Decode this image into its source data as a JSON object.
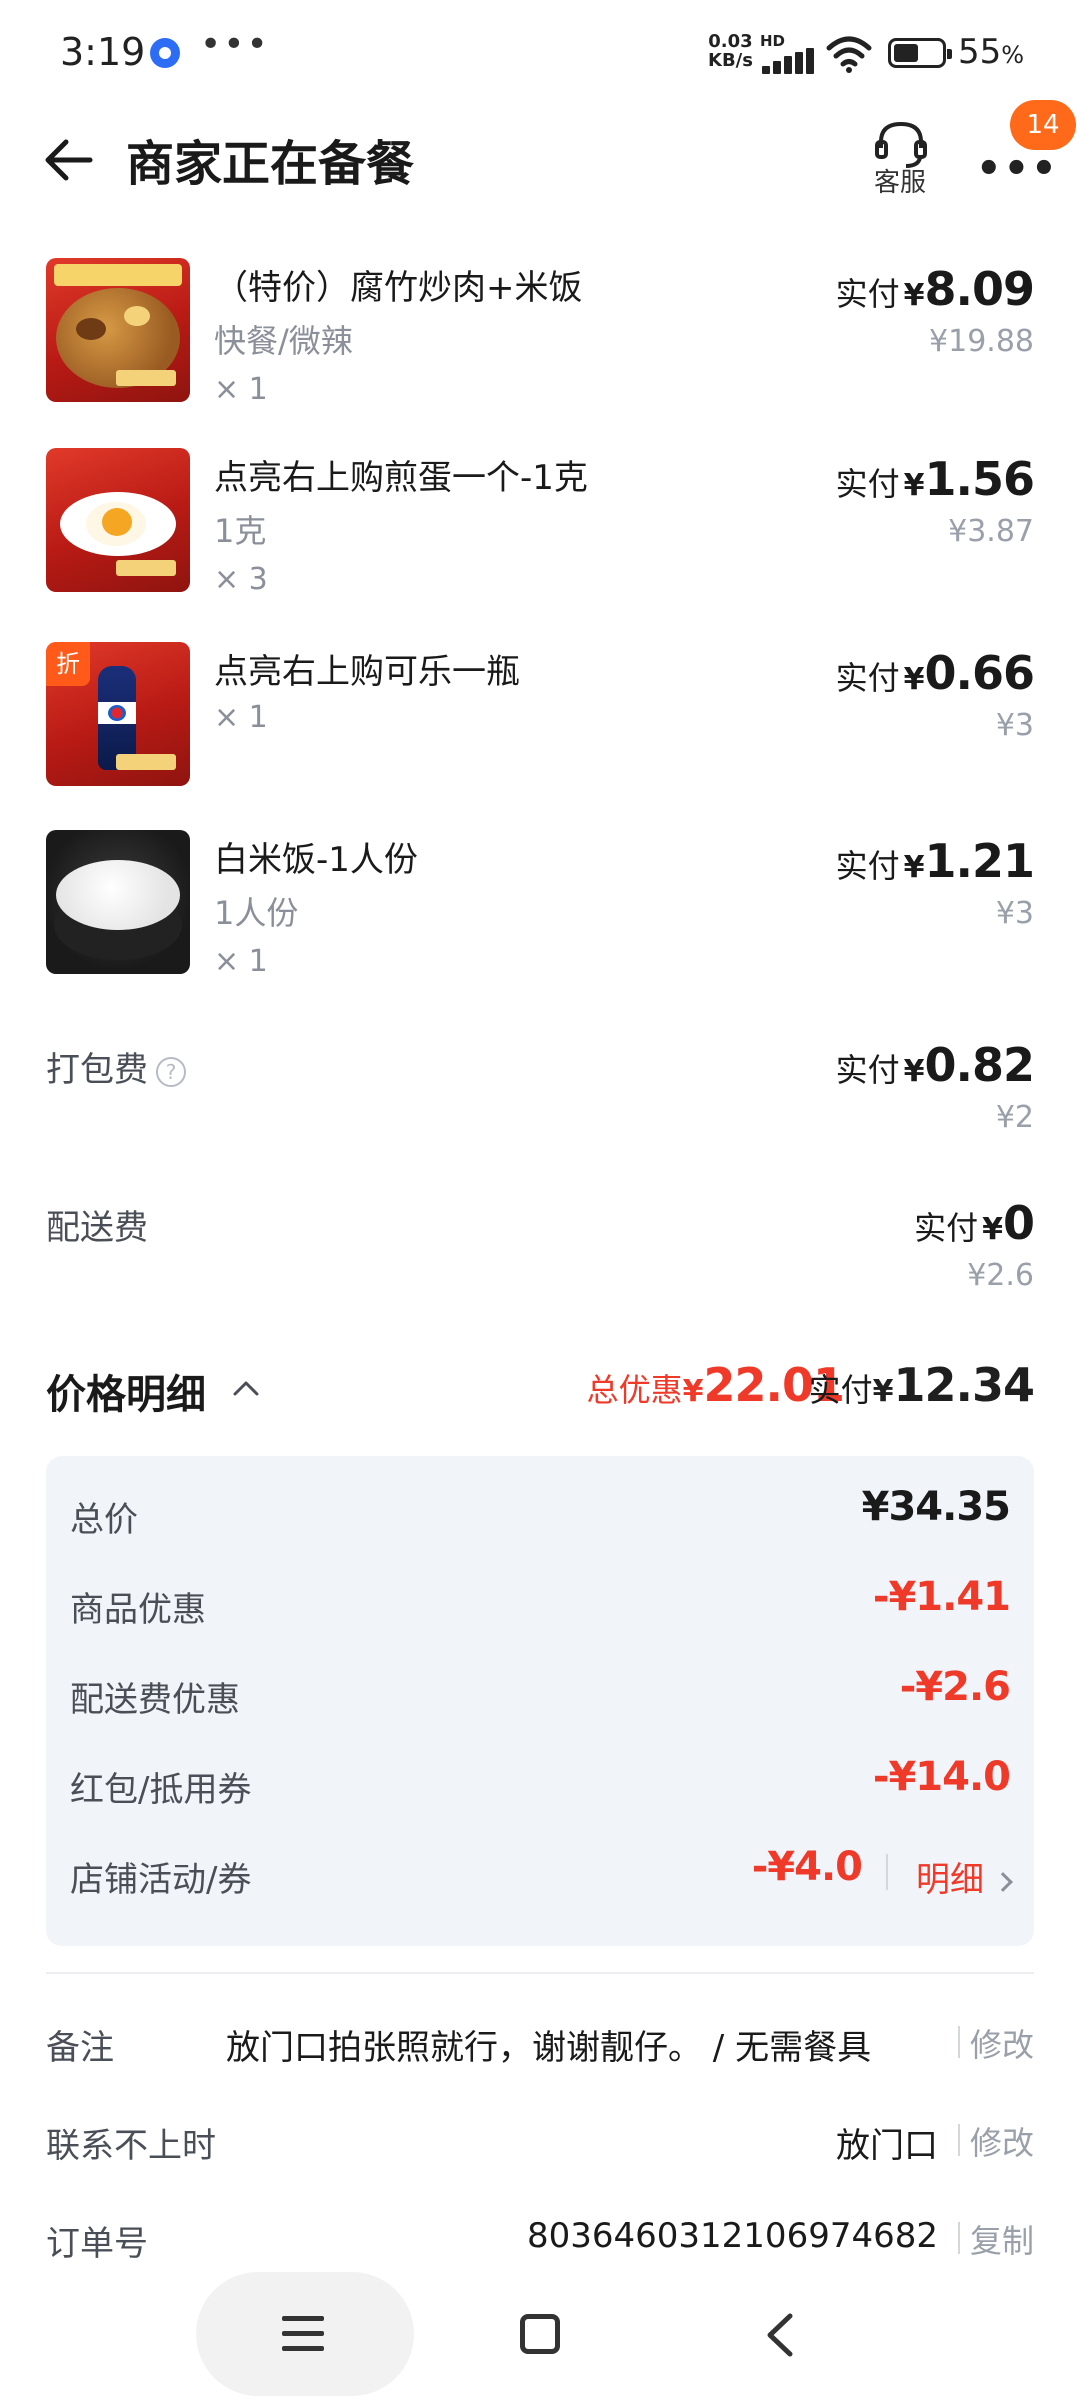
{
  "status_bar": {
    "time": "3:19",
    "dots": "•••",
    "net_speed_top": "0.03",
    "net_speed_bottom": "KB/s",
    "network_type": "HD",
    "battery_level": "55",
    "battery_unit": "%"
  },
  "header": {
    "title": "商家正在备餐",
    "customer_service_label": "客服",
    "notification_count": "14"
  },
  "items": [
    {
      "name": "（特价）腐竹炒肉+米饭",
      "spec": "快餐/微辣",
      "qty": "× 1",
      "pay_label": "实付",
      "yen": "¥",
      "pay": "8.09",
      "original": "¥19.88"
    },
    {
      "name": "点亮右上购煎蛋一个-1克",
      "spec": "1克",
      "qty": "× 3",
      "pay_label": "实付",
      "yen": "¥",
      "pay": "1.56",
      "original": "¥3.87"
    },
    {
      "name": "点亮右上购可乐一瓶",
      "qty": "× 1",
      "tag": "折",
      "pay_label": "实付",
      "yen": "¥",
      "pay": "0.66",
      "original": "¥3"
    },
    {
      "name": "白米饭-1人份",
      "spec": "1人份",
      "qty": "× 1",
      "pay_label": "实付",
      "yen": "¥",
      "pay": "1.21",
      "original": "¥3"
    }
  ],
  "fees": {
    "packing": {
      "label": "打包费",
      "help": "?",
      "pay_label": "实付",
      "yen": "¥",
      "pay": "0.82",
      "original": "¥2"
    },
    "delivery": {
      "label": "配送费",
      "pay_label": "实付",
      "yen": "¥",
      "pay": "0",
      "original": "¥2.6"
    }
  },
  "price_detail": {
    "title": "价格明细",
    "total_discount_label": "总优惠",
    "total_discount_yen": "¥",
    "total_discount": "22.01",
    "paid_label": "实付",
    "paid_yen": "¥",
    "paid": "12.34",
    "rows": [
      {
        "label": "总价",
        "value": "¥34.35"
      },
      {
        "label": "商品优惠",
        "value": "-¥1.41"
      },
      {
        "label": "配送费优惠",
        "value": "-¥2.6"
      },
      {
        "label": "红包/抵用券",
        "value": "-¥14.0"
      },
      {
        "label": "店铺活动/券",
        "value": "-¥4.0",
        "link": "明细"
      }
    ]
  },
  "order_info": {
    "note_label": "备注",
    "note_value": "放门口拍张照就行，谢谢靓仔。 / 无需餐具",
    "note_action": "修改",
    "unreachable_label": "联系不上时",
    "unreachable_value": "放门口",
    "unreachable_action": "修改",
    "order_no_label": "订单号",
    "order_no_value": "8036460312106974682",
    "order_no_action": "复制"
  },
  "colors": {
    "accent_red": "#ef3a2a",
    "badge_orange": "#ff6a1a",
    "detail_bg": "#f1f4f9"
  },
  "icons": [
    "back-arrow-icon",
    "headset-icon",
    "more-icon",
    "help-icon",
    "chevron-up-icon",
    "chevron-right-icon",
    "menu-icon",
    "home-icon",
    "nav-back-icon"
  ]
}
